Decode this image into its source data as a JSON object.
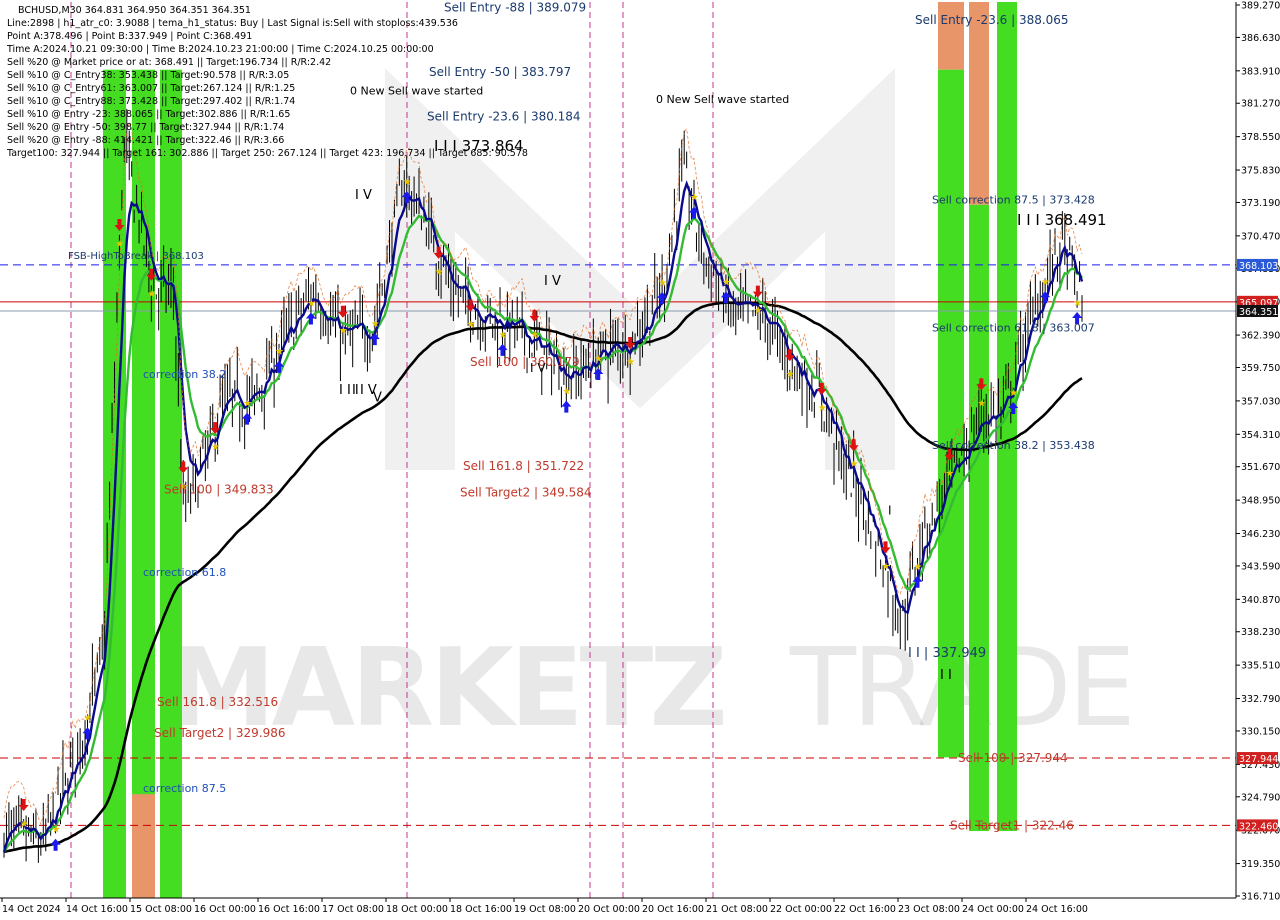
{
  "header": {
    "lines": [
      "BCHUSD,M30  364.831 364.950 364.351 364.351",
      "Line:2898 | h1_atr_c0: 3.9088 | tema_h1_status: Buy | Last Signal is:Sell with stoploss:439.536",
      "Point A:378.496 | Point B:337.949 | Point C:368.491",
      "Time A:2024.10.21 09:30:00 | Time B:2024.10.23 21:00:00 | Time C:2024.10.25 00:00:00",
      "Sell %20 @ Market price or at: 368.491 || Target:196.734 || R/R:2.42",
      "Sell %10 @ C_Entry38: 353.438 || Target:90.578 || R/R:3.05",
      "Sell %10 @ C_Entry61: 363.007 || Target:267.124 || R/R:1.25",
      "Sell %10 @ C_Entry88: 373.428 || Target:297.402 || R/R:1.74",
      "Sell %10 @ Entry -23: 388.065 || Target:302.886 || R/R:1.65",
      "Sell %20 @ Entry -50: 398.77 || Target:327.944 || R/R:1.74",
      "Sell %20 @ Entry -88: 414.421 || Target:322.46 || R/R:3.66",
      "Target100: 327.944 || Target 161: 302.886 || Target 250: 267.124 || Target 423: 196.734 || Target 685: 90.578"
    ]
  },
  "watermark": {
    "left": "MARKETZ",
    "right": "TRADE"
  },
  "colors": {
    "green_zone": "#44dd22",
    "orange_zone": "#e8956a",
    "ma_black": "#000000",
    "ma_navy": "#0a0a8c",
    "ma_green": "#33bb33",
    "red_line": "#cc0000",
    "blue_line": "#1a1aee",
    "label_red": "#c0392b",
    "label_blue": "#1f4fb8",
    "label_dark": "#1a3a6e",
    "candle": "#000000"
  },
  "chart_data": {
    "type": "candlestick",
    "symbol": "BCHUSD,M30",
    "ylim": [
      315.0,
      390.0
    ],
    "price_ticks": [
      "389.270",
      "386.630",
      "383.910",
      "381.270",
      "378.550",
      "375.830",
      "373.190",
      "370.470",
      "367.830",
      "365.110",
      "362.390",
      "359.750",
      "357.030",
      "354.310",
      "351.670",
      "348.950",
      "346.230",
      "343.590",
      "340.870",
      "338.230",
      "335.510",
      "332.790",
      "330.150",
      "327.430",
      "324.790",
      "322.070",
      "319.350",
      "316.710"
    ],
    "x_labels": [
      "14 Oct 2024",
      "14 Oct 16:00",
      "15 Oct 08:00",
      "16 Oct 00:00",
      "16 Oct 16:00",
      "17 Oct 08:00",
      "18 Oct 00:00",
      "18 Oct 16:00",
      "19 Oct 08:00",
      "20 Oct 00:00",
      "20 Oct 16:00",
      "21 Oct 08:00",
      "22 Oct 00:00",
      "22 Oct 16:00",
      "23 Oct 08:00",
      "24 Oct 00:00",
      "24 Oct 16:00"
    ],
    "horizontal_levels": [
      {
        "price": 368.103,
        "label": "368.103",
        "style": "dashed",
        "color": "blue"
      },
      {
        "price": 365.097,
        "label": "365.097",
        "style": "solid",
        "color": "red"
      },
      {
        "price": 364.351,
        "label": "364.351",
        "style": "solid",
        "color": "gray"
      },
      {
        "price": 327.944,
        "label": "327.944",
        "style": "dashed",
        "color": "red"
      },
      {
        "price": 322.46,
        "label": "322.460",
        "style": "dashed",
        "color": "red"
      }
    ],
    "price_path": [
      [
        0,
        322
      ],
      [
        4,
        321
      ],
      [
        8,
        330
      ],
      [
        10,
        337
      ],
      [
        12,
        378
      ],
      [
        15,
        366
      ],
      [
        17,
        366
      ],
      [
        18,
        348
      ],
      [
        20,
        352
      ],
      [
        22,
        357
      ],
      [
        25,
        357
      ],
      [
        28,
        362
      ],
      [
        31,
        366
      ],
      [
        34,
        362
      ],
      [
        37,
        363
      ],
      [
        40,
        375
      ],
      [
        42,
        372
      ],
      [
        45,
        366
      ],
      [
        48,
        364
      ],
      [
        51,
        363
      ],
      [
        54,
        361
      ],
      [
        57,
        359
      ],
      [
        60,
        361
      ],
      [
        63,
        362
      ],
      [
        66,
        366
      ],
      [
        68,
        376
      ],
      [
        70,
        369
      ],
      [
        73,
        364
      ],
      [
        76,
        364
      ],
      [
        79,
        360
      ],
      [
        82,
        357
      ],
      [
        84,
        352
      ],
      [
        86,
        349
      ],
      [
        88,
        344
      ],
      [
        90,
        339
      ],
      [
        92,
        346
      ],
      [
        95,
        351
      ],
      [
        98,
        356
      ],
      [
        100,
        356
      ],
      [
        103,
        364
      ],
      [
        106,
        370
      ],
      [
        108,
        365
      ]
    ],
    "zones": [
      {
        "color": "green",
        "y_top": 384,
        "y_bottom": 315
      },
      {
        "color": "green",
        "y_top": 384,
        "y_bottom": 315
      },
      {
        "color": "orange",
        "y_top": 325,
        "y_bottom": 315
      },
      {
        "color": "green",
        "y_top": 384,
        "y_bottom": 315
      },
      {
        "color": "orange",
        "y_top": 390,
        "y_bottom": 384
      },
      {
        "color": "green",
        "y_top": 384,
        "y_bottom": 328
      },
      {
        "color": "orange",
        "y_top": 390,
        "y_bottom": 373
      },
      {
        "color": "green",
        "y_top": 373,
        "y_bottom": 322
      },
      {
        "color": "green",
        "y_top": 390,
        "y_bottom": 322
      }
    ],
    "annotations": [
      {
        "text": "Sell Entry -88 | 389.079",
        "price": 389.08,
        "color": "label_dark"
      },
      {
        "text": "Sell Entry -23.6 | 388.065",
        "price": 388.06,
        "color": "label_dark"
      },
      {
        "text": "Sell Entry -50 | 383.797",
        "price": 383.8,
        "color": "label_dark"
      },
      {
        "text": "0 New Sell wave started",
        "price": 382.3,
        "color": "candle"
      },
      {
        "text": "0 New Sell wave started",
        "price": 381.6,
        "color": "candle"
      },
      {
        "text": "Sell Entry -23.6 | 380.184",
        "price": 380.18,
        "color": "label_dark"
      },
      {
        "text": "I I I 373.864",
        "price": 377.7,
        "color": "candle"
      },
      {
        "text": "I V",
        "price": 373.8,
        "color": "candle"
      },
      {
        "text": "Sell correction 87.5 | 373.428",
        "price": 373.43,
        "color": "label_dark"
      },
      {
        "text": "I I I 368.491",
        "price": 371.7,
        "color": "candle"
      },
      {
        "text": "FSB-HighToBreak | 368.103",
        "price": 368.9,
        "color": "label_dark"
      },
      {
        "text": "I V",
        "price": 366.8,
        "color": "candle"
      },
      {
        "text": "Sell correction 61.8 | 363.007",
        "price": 363.0,
        "color": "label_dark"
      },
      {
        "text": "Sell 100 | 360.179",
        "price": 360.18,
        "color": "label_red"
      },
      {
        "text": "I V",
        "price": 359.7,
        "color": "candle"
      },
      {
        "text": "correction 38.2",
        "price": 359.2,
        "color": "label_blue"
      },
      {
        "text": "I I I",
        "price": 357.9,
        "color": "candle"
      },
      {
        "text": "V",
        "price": 357.3,
        "color": "candle"
      },
      {
        "text": "I I V",
        "price": 357.9,
        "color": "candle"
      },
      {
        "text": "Sell correction 38.2 | 353.438",
        "price": 353.44,
        "color": "label_dark"
      },
      {
        "text": "Sell 161.8 | 351.722",
        "price": 351.72,
        "color": "label_red"
      },
      {
        "text": "Sell 100 | 349.833",
        "price": 349.83,
        "color": "label_red"
      },
      {
        "text": "Sell Target2 | 349.584",
        "price": 349.58,
        "color": "label_red"
      },
      {
        "text": "I",
        "price": 348.1,
        "color": "candle"
      },
      {
        "text": "correction 61.8",
        "price": 343.1,
        "color": "label_blue"
      },
      {
        "text": "I I | 337.949",
        "price": 336.5,
        "color": "label_dark"
      },
      {
        "text": "I I",
        "price": 334.7,
        "color": "candle"
      },
      {
        "text": "Sell 161.8 | 332.516",
        "price": 332.52,
        "color": "label_red"
      },
      {
        "text": "Sell Target2 | 329.986",
        "price": 329.99,
        "color": "label_red"
      },
      {
        "text": "Sell 100 | 327.944",
        "price": 327.94,
        "color": "label_red"
      },
      {
        "text": "correction 87.5",
        "price": 325.5,
        "color": "label_blue"
      },
      {
        "text": "Sell Target1 | 322.46",
        "price": 322.46,
        "color": "label_red"
      }
    ],
    "grid": false,
    "legend": "none"
  }
}
